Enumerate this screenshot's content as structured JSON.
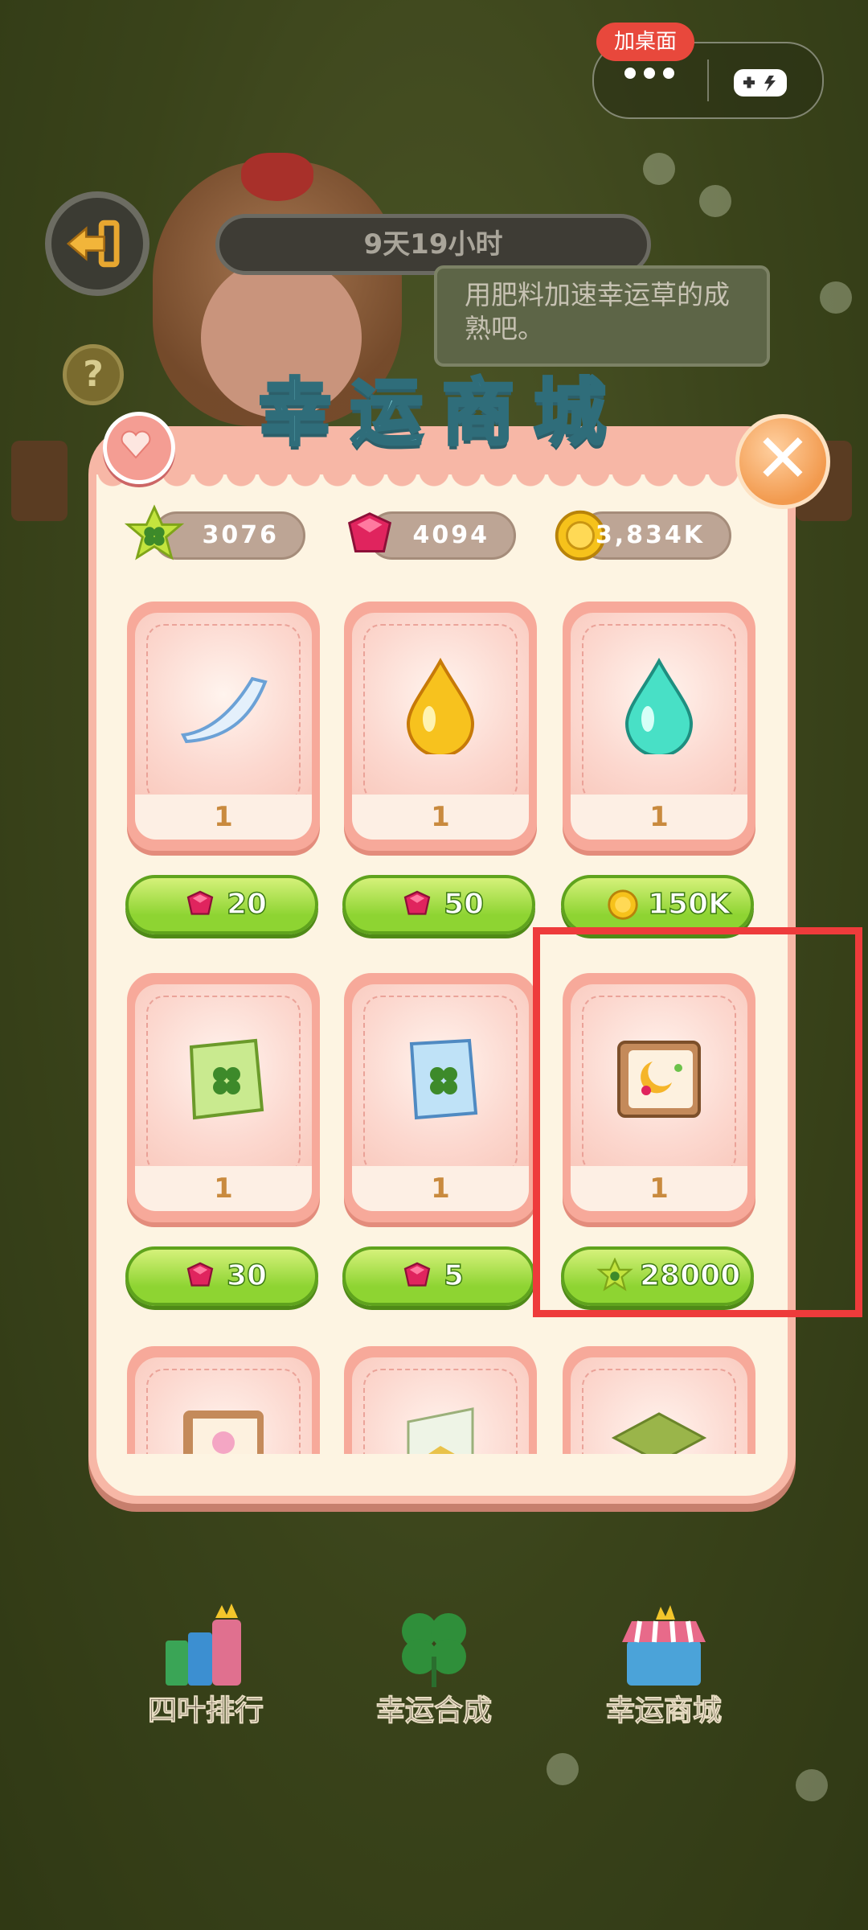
{
  "capsule": {
    "add_desktop": "加桌面",
    "more_icon": "more-dots-icon",
    "game_icon": "gamepad-icon"
  },
  "header": {
    "timer": "9天19小时",
    "tip": "用肥料加速幸运草的成熟吧。",
    "title": "幸运商城"
  },
  "currencies": [
    {
      "icon": "clover-star-icon",
      "value": "3076"
    },
    {
      "icon": "ruby-gem-icon",
      "value": "4094"
    },
    {
      "icon": "gold-coin-icon",
      "value": "3,834K"
    }
  ],
  "shop": {
    "rows": [
      [
        {
          "item": "white-feather",
          "qty": "1",
          "price_icon": "ruby-gem-icon",
          "price": "20"
        },
        {
          "item": "golden-drop",
          "qty": "1",
          "price_icon": "ruby-gem-icon",
          "price": "50"
        },
        {
          "item": "teal-drop",
          "qty": "1",
          "price_icon": "gold-coin-icon",
          "price": "150K"
        }
      ],
      [
        {
          "item": "green-seed-bag",
          "qty": "1",
          "price_icon": "ruby-gem-icon",
          "price": "30"
        },
        {
          "item": "blue-seed-bag",
          "qty": "1",
          "price_icon": "ruby-gem-icon",
          "price": "5"
        },
        {
          "item": "moon-picture-scroll",
          "qty": "1",
          "price_icon": "clover-star-icon",
          "price": "28000"
        }
      ]
    ]
  },
  "bottom_nav": [
    {
      "label": "四叶排行",
      "icon": "ranking-icon"
    },
    {
      "label": "幸运合成",
      "icon": "four-leaf-clover-icon"
    },
    {
      "label": "幸运商城",
      "icon": "shop-stall-icon"
    }
  ],
  "colors": {
    "accent_green": "#8ed432",
    "panel_pink": "#f7b7a6",
    "ruby": "#e0245e",
    "highlight_red": "#ee3b3b"
  }
}
